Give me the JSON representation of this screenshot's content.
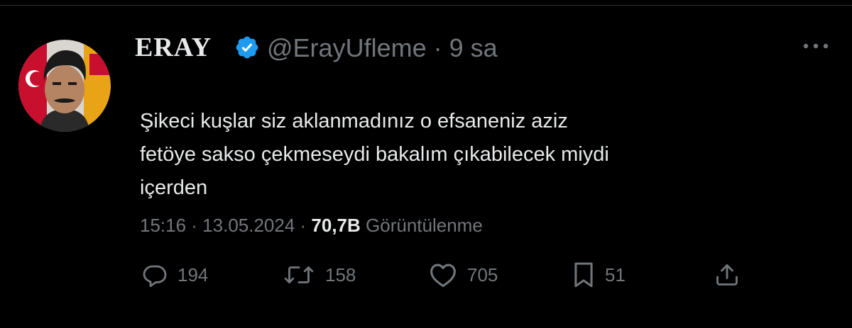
{
  "colors": {
    "background": "#000000",
    "text_primary": "#e7e9ea",
    "text_secondary": "#71767b",
    "verified_blue": "#1d9bf0"
  },
  "tweet": {
    "author_name": "ERAY",
    "verified_icon": "verified-badge-icon",
    "handle_and_time": "@ErayUfleme · 9 sa",
    "text_lines": [
      "Şikeci kuşlar siz aklanmadınız o efsaneniz aziz",
      "fetöye sakso çekmeseydi bakalım çıkabilecek miydi",
      "içerden"
    ],
    "timestamp": "15:16 · 13.05.2024 · ",
    "views_count": "70,7B",
    "views_label": " Görüntülenme"
  },
  "actions": {
    "reply": {
      "icon": "reply-icon",
      "count": "194"
    },
    "retweet": {
      "icon": "retweet-icon",
      "count": "158"
    },
    "like": {
      "icon": "heart-icon",
      "count": "705"
    },
    "bookmark": {
      "icon": "bookmark-icon",
      "count": "51"
    },
    "share": {
      "icon": "share-icon"
    }
  },
  "more_icon": "more-icon"
}
